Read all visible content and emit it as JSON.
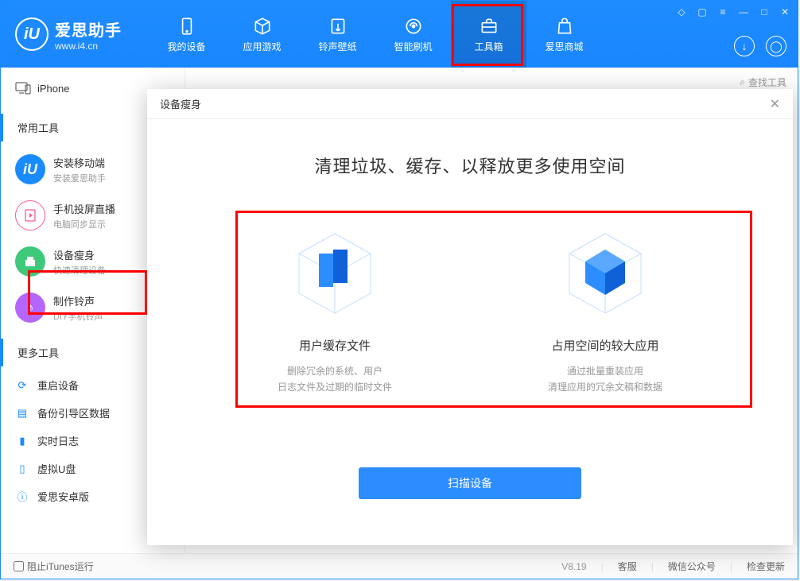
{
  "app": {
    "name": "爱思助手",
    "url": "www.i4.cn"
  },
  "nav": {
    "tabs": [
      {
        "label": "我的设备"
      },
      {
        "label": "应用游戏"
      },
      {
        "label": "铃声壁纸"
      },
      {
        "label": "智能刷机"
      },
      {
        "label": "工具箱"
      },
      {
        "label": "爱思商城"
      }
    ]
  },
  "device_name": "iPhone",
  "search_placeholder": "查找工具",
  "sections": {
    "common": "常用工具",
    "more": "更多工具"
  },
  "tools": [
    {
      "title": "安装移动端",
      "desc": "安装爱思助手"
    },
    {
      "title": "手机投屏直播",
      "desc": "电脑同步显示"
    },
    {
      "title": "设备瘦身",
      "desc": "快速清理设备"
    },
    {
      "title": "制作铃声",
      "desc": "DIY手机铃声"
    }
  ],
  "more_tools": [
    "重启设备",
    "备份引导区数据",
    "实时日志",
    "虚拟U盘",
    "爱思安卓版"
  ],
  "modal": {
    "header": "设备瘦身",
    "title": "清理垃圾、缓存、以释放更多使用空间",
    "options": [
      {
        "title": "用户缓存文件",
        "desc1": "删除冗余的系统、用户",
        "desc2": "日志文件及过期的临时文件"
      },
      {
        "title": "占用空间的较大应用",
        "desc1": "通过批量重装应用",
        "desc2": "清理应用的冗余文稿和数据"
      }
    ],
    "scan_button": "扫描设备"
  },
  "footer": {
    "block_itunes": "阻止iTunes运行",
    "version": "V8.19",
    "support": "客服",
    "wechat": "微信公众号",
    "update": "检查更新"
  }
}
